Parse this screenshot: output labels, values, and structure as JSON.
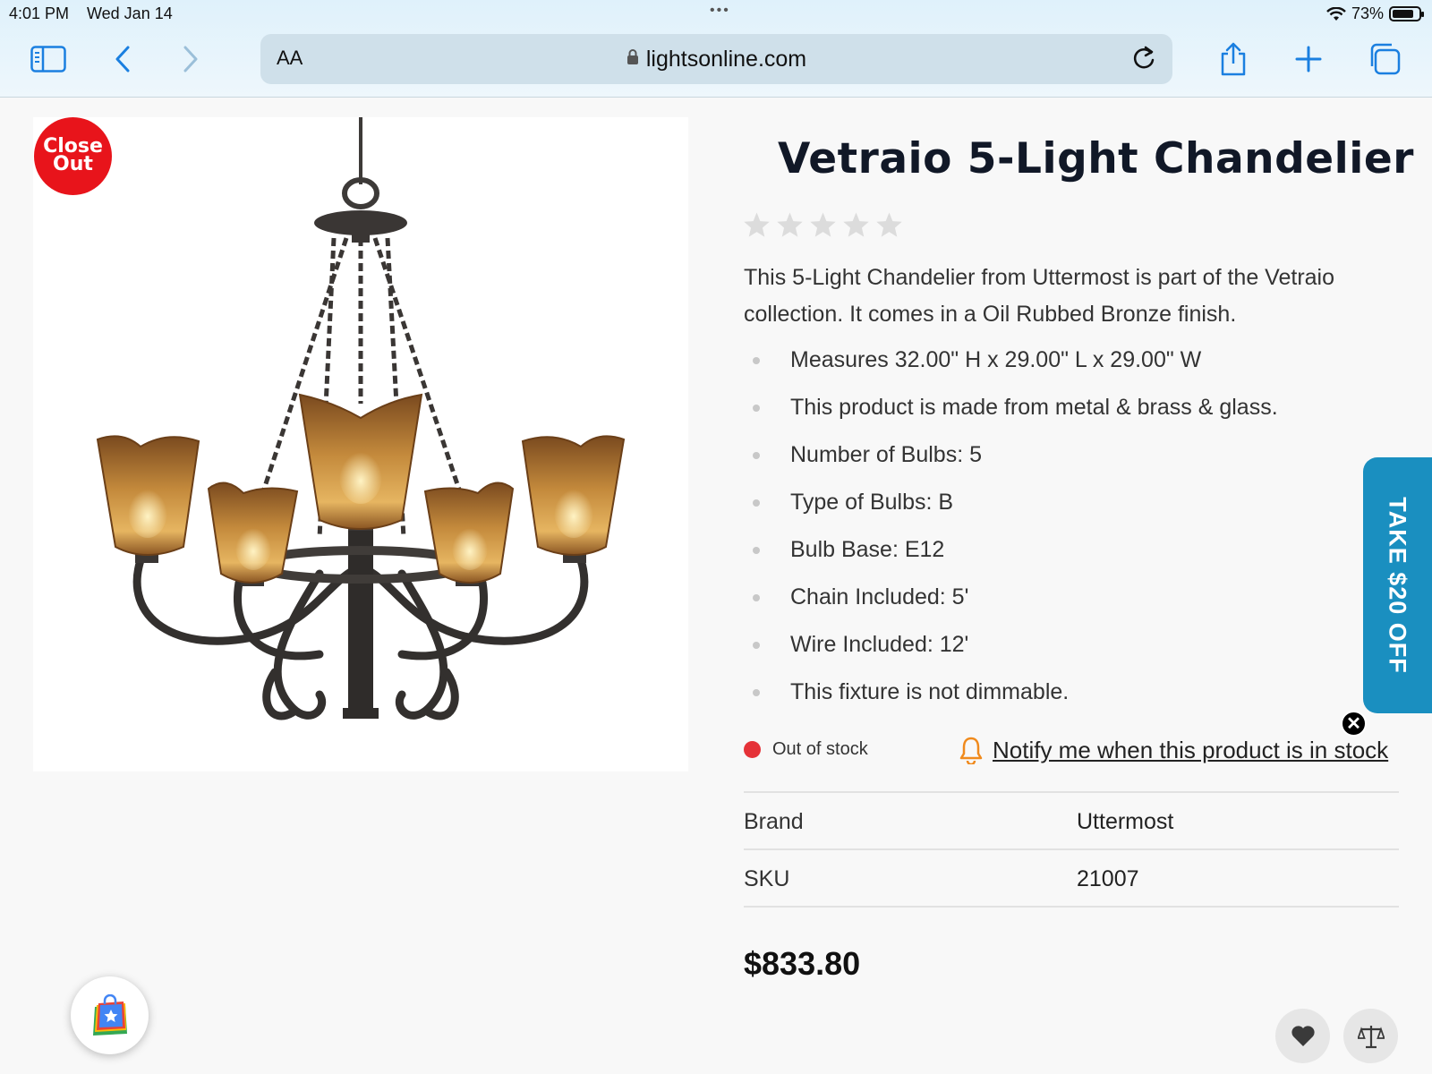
{
  "status_bar": {
    "time": "4:01 PM",
    "date": "Wed Jan 14",
    "battery": "73%"
  },
  "browser": {
    "text_size_label": "AA",
    "url": "lightsonline.com"
  },
  "badge": {
    "line1": "Close",
    "line2": "Out"
  },
  "product": {
    "title": "Vetraio 5-Light Chandelier",
    "rating": 0,
    "description": "This 5-Light Chandelier from Uttermost is part of the Vetraio collection. It comes in a Oil Rubbed Bronze finish.",
    "features": [
      "Measures 32.00\" H x 29.00\" L x 29.00\" W",
      "This product is made from metal & brass & glass.",
      "Number of Bulbs: 5",
      "Type of Bulbs: B",
      "Bulb Base: E12",
      "Chain Included: 5'",
      "Wire Included: 12'",
      "This fixture is not dimmable."
    ],
    "stock_status": "Out of stock",
    "notify_label": "Notify me when this product is in stock",
    "specs": [
      {
        "label": "Brand",
        "value": "Uttermost"
      },
      {
        "label": "SKU",
        "value": "21007"
      }
    ],
    "price": "$833.80"
  },
  "promo": {
    "label": "TAKE $20 OFF"
  },
  "colors": {
    "accent_blue": "#1a8fc0",
    "badge_red": "#e8141b",
    "stock_red": "#e53238",
    "notify_orange": "#f08a1c"
  }
}
